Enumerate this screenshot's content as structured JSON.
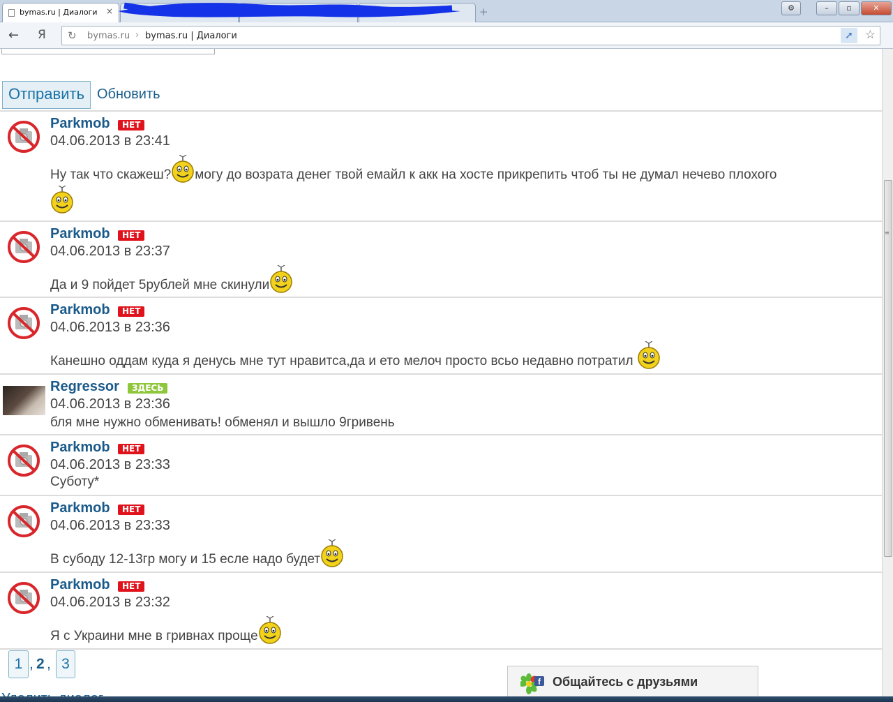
{
  "browser": {
    "tab_title": "bymas.ru | Диалоги",
    "tab_close": "×",
    "new_tab": "+",
    "address": {
      "host": "bymas.ru",
      "separator": "›",
      "title": "bymas.ru | Диалоги"
    },
    "nav": {
      "back": "←",
      "yandex": "Я",
      "reload": "↻",
      "star": "☆"
    },
    "window": {
      "gear": "⚙",
      "minimize": "–",
      "maximize": "▫",
      "close": "✕"
    }
  },
  "form": {
    "send_label": "Отправить",
    "refresh_label": "Обновить"
  },
  "status_labels": {
    "offline": "НЕТ",
    "online": "ЗДЕСЬ"
  },
  "colors": {
    "link": "#1a5a8a",
    "offline_badge": "#e0121b",
    "online_badge": "#8fc73c",
    "button_border": "#7fb0c9"
  },
  "messages": [
    {
      "author": "Parkmob",
      "status": "offline",
      "avatar": "no-photo-icon",
      "date": "04.06.2013 в 23:41",
      "text_before": "Ну так что скажеш?",
      "text_after": "могу до возрата денег твой емайл к акк на хосте прикрепить чтоб ты не думал нечево плохого"
    },
    {
      "author": "Parkmob",
      "status": "offline",
      "avatar": "no-photo-icon",
      "date": "04.06.2013 в 23:37",
      "text": "Да и 9 пойдет 5рублей мне скинули"
    },
    {
      "author": "Parkmob",
      "status": "offline",
      "avatar": "no-photo-icon",
      "date": "04.06.2013 в 23:36",
      "text": "Канешно оддам куда я денусь мне тут нравитса,да и ето мелоч просто всьо недавно потратил"
    },
    {
      "author": "Regressor",
      "status": "online",
      "avatar": "user-photo",
      "date": "04.06.2013 в 23:36",
      "text": "бля мне нужно обменивать! обменял и вышло 9гривень"
    },
    {
      "author": "Parkmob",
      "status": "offline",
      "avatar": "no-photo-icon",
      "date": "04.06.2013 в 23:33",
      "text": "Суботу*"
    },
    {
      "author": "Parkmob",
      "status": "offline",
      "avatar": "no-photo-icon",
      "date": "04.06.2013 в 23:33",
      "text": "В субоду 12-13гр могу и 15 есле надо будет"
    },
    {
      "author": "Parkmob",
      "status": "offline",
      "avatar": "no-photo-icon",
      "date": "04.06.2013 в 23:32",
      "text": "Я с Украини мне в гривнах проще"
    }
  ],
  "pagination": {
    "pages": [
      "1",
      "2",
      "3"
    ],
    "separator": ",",
    "current": "2"
  },
  "delete_dialog": "Удалить диалог",
  "friends_bar": {
    "label": "Общайтесь с друзьями",
    "icons": [
      "icq-flower-icon",
      "facebook-icon"
    ]
  }
}
